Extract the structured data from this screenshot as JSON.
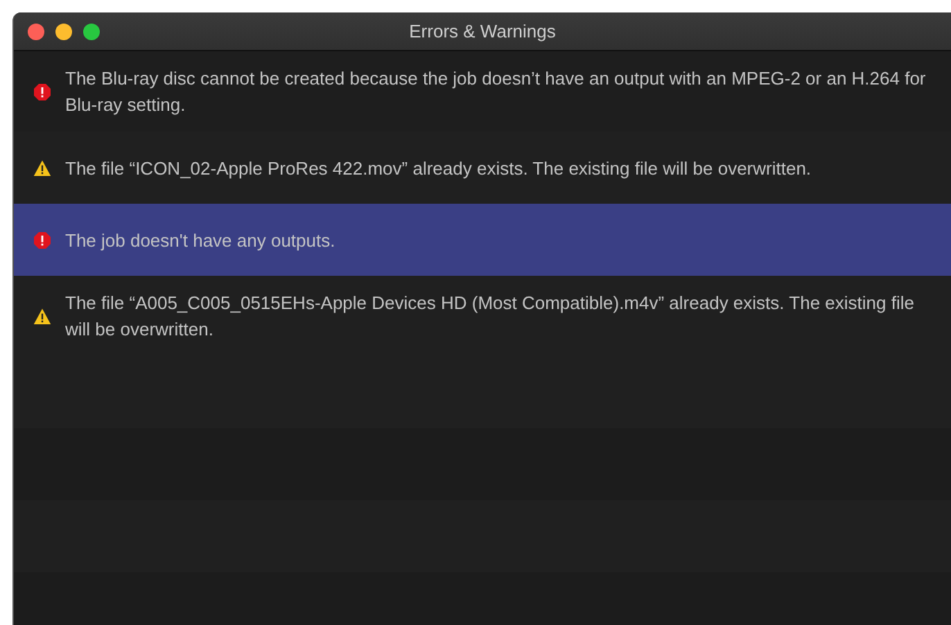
{
  "window": {
    "title": "Errors & Warnings"
  },
  "messages": [
    {
      "kind": "error",
      "text": "The Blu-ray disc cannot be created because the job doesn’t have an output with an MPEG-2 or an H.264 for Blu-ray setting.",
      "selected": false
    },
    {
      "kind": "warning",
      "text": "The file “ICON_02-Apple ProRes 422.mov” already exists. The existing file will be overwritten.",
      "selected": false
    },
    {
      "kind": "error",
      "text": "The job doesn't have any outputs.",
      "selected": true
    },
    {
      "kind": "warning",
      "text": "The file “A005_C005_0515EHs-Apple Devices HD (Most Compatible).m4v” already exists. The existing file will be overwritten.",
      "selected": false
    }
  ]
}
